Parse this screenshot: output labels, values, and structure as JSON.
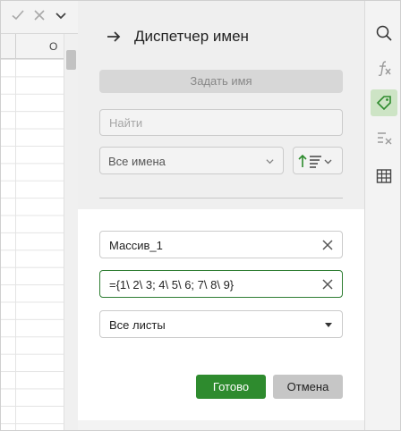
{
  "formula_bar": {
    "confirm_icon": "check-icon",
    "cancel_icon": "close-icon",
    "expand_icon": "chevron-down-icon"
  },
  "sheet": {
    "column_label": "O"
  },
  "panel": {
    "title": "Диспетчер имен",
    "back_icon": "arrow-right-icon",
    "define_name_label": "Задать имя",
    "search_placeholder": "Найти",
    "filter_value": "Все имена",
    "sort_icon": "sort-icon"
  },
  "editor": {
    "name_value": "Массив_1",
    "reference_value": "={1\\ 2\\ 3; 4\\ 5\\ 6; 7\\ 8\\ 9}",
    "scope_value": "Все листы",
    "ok_label": "Готово",
    "cancel_label": "Отмена"
  },
  "rail": {
    "items": [
      "search-icon",
      "function-icon",
      "name-tag-icon",
      "clear-formula-icon",
      "table-icon"
    ],
    "active_index": 2
  },
  "colors": {
    "accent": "#2e8b2e",
    "active_bg": "#cde4c5"
  }
}
